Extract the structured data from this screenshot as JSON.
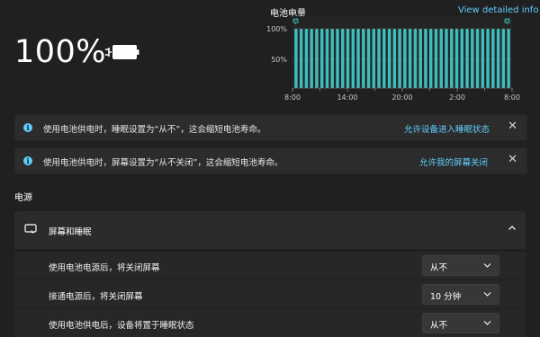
{
  "battery": {
    "percent_label": "100%",
    "level": 1.0
  },
  "chart_data": {
    "type": "bar",
    "title": "电池电量",
    "link": "View detailed info",
    "y_tick_labels": [
      "100%",
      "50%"
    ],
    "x_tick_labels": [
      "8:00",
      "14:00",
      "20:00",
      "2:00",
      "8:00"
    ],
    "ylim": [
      0,
      100
    ],
    "grid": true,
    "bar_color": "#3fbdbd",
    "values": [
      100,
      100,
      100,
      100,
      100,
      100,
      100,
      100,
      100,
      100,
      100,
      100,
      100,
      100,
      100,
      100,
      100,
      100,
      100,
      100,
      100,
      100,
      100,
      100,
      100,
      100,
      100,
      100,
      100,
      100,
      100,
      100,
      100,
      100,
      100,
      100,
      100,
      100,
      100,
      100,
      100,
      100
    ],
    "charging_markers": [
      "start",
      "end"
    ]
  },
  "notices": [
    {
      "message": "使用电池供电时，睡眠设置为“从不”，这会缩短电池寿命。",
      "action": "允许设备进入睡眠状态"
    },
    {
      "message": "使用电池供电时，屏幕设置为“从不关闭”，这会缩短电池寿命。",
      "action": "允许我的屏幕关闭"
    }
  ],
  "section": {
    "title": "电源"
  },
  "screen_sleep": {
    "title": "屏幕和睡眠",
    "rows": [
      {
        "label": "使用电池电源后，将关闭屏幕",
        "value": "从不"
      },
      {
        "label": "接通电源后，将关闭屏幕",
        "value": "10 分钟"
      },
      {
        "label": "使用电池供电后，设备将置于睡眠状态",
        "value": "从不"
      }
    ]
  },
  "colors": {
    "accent": "#60cdff",
    "bar": "#3fbdbd",
    "background": "#202020"
  }
}
